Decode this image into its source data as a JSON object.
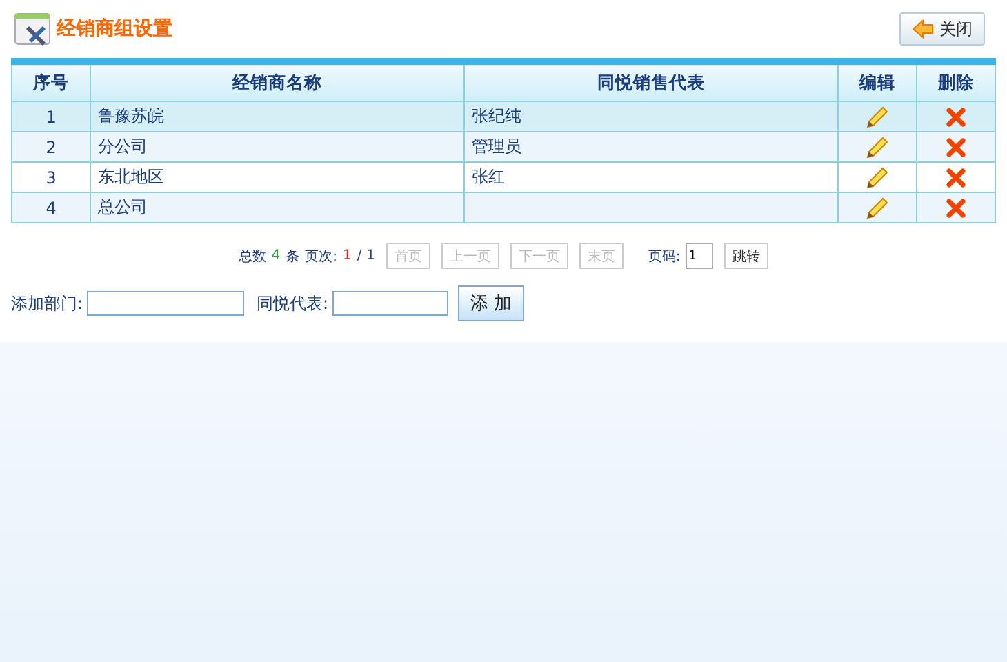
{
  "header": {
    "title": "经销商组设置",
    "close_button": "关闭"
  },
  "table": {
    "columns": [
      "序号",
      "经销商名称",
      "同悦销售代表",
      "编辑",
      "删除"
    ],
    "rows": [
      {
        "index": "1",
        "name": "鲁豫苏皖",
        "rep": "张纪纯",
        "selected": true
      },
      {
        "index": "2",
        "name": "分公司",
        "rep": "管理员",
        "selected": false
      },
      {
        "index": "3",
        "name": "东北地区",
        "rep": "张红",
        "selected": false
      },
      {
        "index": "4",
        "name": "总公司",
        "rep": "",
        "selected": false
      }
    ]
  },
  "pager": {
    "total_label": "总数",
    "total": "4",
    "unit": "条",
    "page_label": "页次:",
    "current_page": "1",
    "page_count": "/ 1",
    "buttons": [
      {
        "label": "首页",
        "disabled": true
      },
      {
        "label": "上一页",
        "disabled": true
      },
      {
        "label": "下一页",
        "disabled": true
      },
      {
        "label": "末页",
        "disabled": true
      }
    ],
    "goto_label": "页码:",
    "goto_value": "1",
    "goto_button": "跳转"
  },
  "add_form": {
    "department_label": "添加部门:",
    "rep_label": "同悦代表:",
    "add_button": "添 加"
  }
}
